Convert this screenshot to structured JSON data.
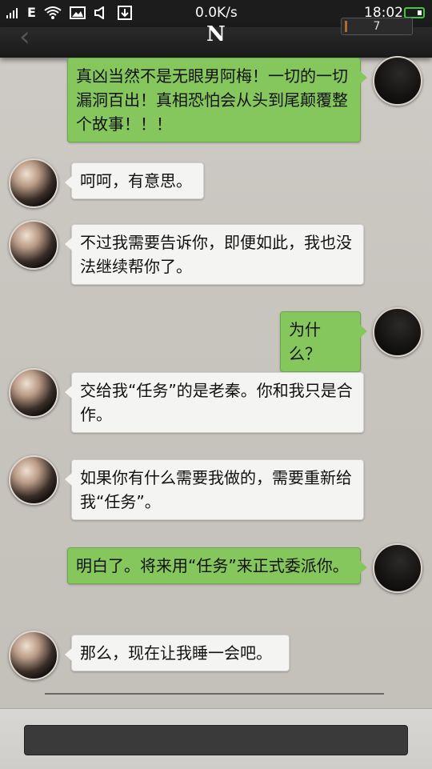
{
  "status_bar": {
    "network": "E",
    "speed": "0.0K/s",
    "time": "18:02"
  },
  "header": {
    "back_icon": "chevron-left-icon",
    "logo": "N",
    "counter": "7"
  },
  "messages": [
    {
      "side": "right",
      "text": "真凶当然不是无眼男阿梅！一切的一切漏洞百出！真相恐怕会从头到尾颠覆整个故事！！！"
    },
    {
      "side": "left",
      "text": "呵呵，有意思。"
    },
    {
      "side": "left",
      "text": "不过我需要告诉你，即便如此，我也没法继续帮你了。"
    },
    {
      "side": "right",
      "text": "为什么？"
    },
    {
      "side": "left",
      "text": "交给我“任务”的是老秦。你和我只是合作。"
    },
    {
      "side": "left",
      "text": "如果你有什么需要我做的，需要重新给我“任务”。"
    },
    {
      "side": "right",
      "text": "明白了。将来用“任务”来正式委派你。"
    },
    {
      "side": "left",
      "text": "那么，现在让我睡一会吧。"
    }
  ],
  "input": {
    "value": ""
  }
}
